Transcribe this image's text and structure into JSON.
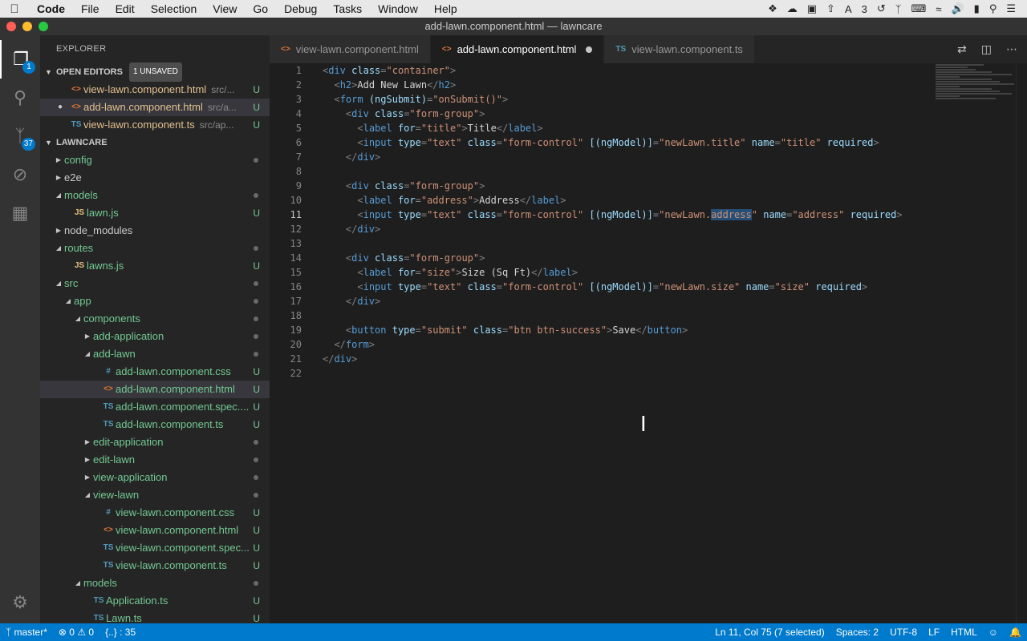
{
  "menubar": {
    "app": "Code",
    "items": [
      "File",
      "Edit",
      "Selection",
      "View",
      "Go",
      "Debug",
      "Tasks",
      "Window",
      "Help"
    ],
    "tray_number": "3"
  },
  "window": {
    "title": "add-lawn.component.html — lawncare"
  },
  "activity": {
    "explorer_badge": "1",
    "scm_badge": "37"
  },
  "sidebar": {
    "title": "EXPLORER",
    "open_editors": {
      "header": "OPEN EDITORS",
      "badge": "1 UNSAVED",
      "items": [
        {
          "icon": "<>",
          "name": "view-lawn.component.html",
          "path": "src/...",
          "status": "U"
        },
        {
          "icon": "<>",
          "name": "add-lawn.component.html",
          "path": "src/a...",
          "status": "U"
        },
        {
          "icon": "TS",
          "name": "view-lawn.component.ts",
          "path": "src/ap...",
          "status": "U"
        }
      ]
    },
    "project": {
      "header": "LAWNCARE",
      "tree": [
        {
          "name": "config",
          "type": "folder",
          "level": 0,
          "expanded": false,
          "mark": "dot"
        },
        {
          "name": "e2e",
          "type": "folder",
          "level": 0,
          "expanded": false,
          "mark": ""
        },
        {
          "name": "models",
          "type": "folder",
          "level": 0,
          "expanded": true,
          "mark": "dot"
        },
        {
          "name": "lawn.js",
          "type": "js",
          "level": 1,
          "mark": "U"
        },
        {
          "name": "node_modules",
          "type": "folder",
          "level": 0,
          "expanded": false,
          "mark": ""
        },
        {
          "name": "routes",
          "type": "folder",
          "level": 0,
          "expanded": true,
          "mark": "dot"
        },
        {
          "name": "lawns.js",
          "type": "js",
          "level": 1,
          "mark": "U"
        },
        {
          "name": "src",
          "type": "folder",
          "level": 0,
          "expanded": true,
          "mark": "dot"
        },
        {
          "name": "app",
          "type": "folder",
          "level": 1,
          "expanded": true,
          "mark": "dot"
        },
        {
          "name": "components",
          "type": "folder",
          "level": 2,
          "expanded": true,
          "mark": "dot"
        },
        {
          "name": "add-application",
          "type": "folder",
          "level": 3,
          "expanded": false,
          "mark": "dot"
        },
        {
          "name": "add-lawn",
          "type": "folder",
          "level": 3,
          "expanded": true,
          "mark": "dot"
        },
        {
          "name": "add-lawn.component.css",
          "type": "css",
          "level": 4,
          "mark": "U"
        },
        {
          "name": "add-lawn.component.html",
          "type": "html",
          "level": 4,
          "mark": "U",
          "selected": true
        },
        {
          "name": "add-lawn.component.spec....",
          "type": "ts",
          "level": 4,
          "mark": "U"
        },
        {
          "name": "add-lawn.component.ts",
          "type": "ts",
          "level": 4,
          "mark": "U"
        },
        {
          "name": "edit-application",
          "type": "folder",
          "level": 3,
          "expanded": false,
          "mark": "dot"
        },
        {
          "name": "edit-lawn",
          "type": "folder",
          "level": 3,
          "expanded": false,
          "mark": "dot"
        },
        {
          "name": "view-application",
          "type": "folder",
          "level": 3,
          "expanded": false,
          "mark": "dot"
        },
        {
          "name": "view-lawn",
          "type": "folder",
          "level": 3,
          "expanded": true,
          "mark": "dot"
        },
        {
          "name": "view-lawn.component.css",
          "type": "css",
          "level": 4,
          "mark": "U"
        },
        {
          "name": "view-lawn.component.html",
          "type": "html",
          "level": 4,
          "mark": "U"
        },
        {
          "name": "view-lawn.component.spec...",
          "type": "ts",
          "level": 4,
          "mark": "U"
        },
        {
          "name": "view-lawn.component.ts",
          "type": "ts",
          "level": 4,
          "mark": "U"
        },
        {
          "name": "models",
          "type": "folder",
          "level": 2,
          "expanded": true,
          "mark": "dot"
        },
        {
          "name": "Application.ts",
          "type": "ts",
          "level": 3,
          "mark": "U"
        },
        {
          "name": "Lawn.ts",
          "type": "ts",
          "level": 3,
          "mark": "U"
        }
      ]
    }
  },
  "tabs": [
    {
      "icon": "<>",
      "label": "view-lawn.component.html",
      "active": false,
      "modified": false
    },
    {
      "icon": "<>",
      "label": "add-lawn.component.html",
      "active": true,
      "modified": true
    },
    {
      "icon": "TS",
      "label": "view-lawn.component.ts",
      "active": false,
      "modified": false
    }
  ],
  "editor": {
    "current_line": 11,
    "lines": [
      [
        [
          "b",
          "<"
        ],
        [
          "t",
          "div"
        ],
        [
          "a",
          " class"
        ],
        [
          "b",
          "="
        ],
        [
          "s",
          "\"container\""
        ],
        [
          "b",
          ">"
        ]
      ],
      [
        [
          "x",
          "  "
        ],
        [
          "b",
          "<"
        ],
        [
          "t",
          "h2"
        ],
        [
          "b",
          ">"
        ],
        [
          "x",
          "Add New Lawn"
        ],
        [
          "b",
          "</"
        ],
        [
          "t",
          "h2"
        ],
        [
          "b",
          ">"
        ]
      ],
      [
        [
          "x",
          "  "
        ],
        [
          "b",
          "<"
        ],
        [
          "t",
          "form"
        ],
        [
          "a",
          " (ngSubmit)"
        ],
        [
          "b",
          "="
        ],
        [
          "s",
          "\"onSubmit()\""
        ],
        [
          "b",
          ">"
        ]
      ],
      [
        [
          "x",
          "    "
        ],
        [
          "b",
          "<"
        ],
        [
          "t",
          "div"
        ],
        [
          "a",
          " class"
        ],
        [
          "b",
          "="
        ],
        [
          "s",
          "\"form-group\""
        ],
        [
          "b",
          ">"
        ]
      ],
      [
        [
          "x",
          "      "
        ],
        [
          "b",
          "<"
        ],
        [
          "t",
          "label"
        ],
        [
          "a",
          " for"
        ],
        [
          "b",
          "="
        ],
        [
          "s",
          "\"title\""
        ],
        [
          "b",
          ">"
        ],
        [
          "x",
          "Title"
        ],
        [
          "b",
          "</"
        ],
        [
          "t",
          "label"
        ],
        [
          "b",
          ">"
        ]
      ],
      [
        [
          "x",
          "      "
        ],
        [
          "b",
          "<"
        ],
        [
          "t",
          "input"
        ],
        [
          "a",
          " type"
        ],
        [
          "b",
          "="
        ],
        [
          "s",
          "\"text\""
        ],
        [
          "a",
          " class"
        ],
        [
          "b",
          "="
        ],
        [
          "s",
          "\"form-control\""
        ],
        [
          "a",
          " [(ngModel)]"
        ],
        [
          "b",
          "="
        ],
        [
          "s",
          "\"newLawn.title\""
        ],
        [
          "a",
          " name"
        ],
        [
          "b",
          "="
        ],
        [
          "s",
          "\"title\""
        ],
        [
          "a",
          " required"
        ],
        [
          "b",
          ">"
        ]
      ],
      [
        [
          "x",
          "    "
        ],
        [
          "b",
          "</"
        ],
        [
          "t",
          "div"
        ],
        [
          "b",
          ">"
        ]
      ],
      [],
      [
        [
          "x",
          "    "
        ],
        [
          "b",
          "<"
        ],
        [
          "t",
          "div"
        ],
        [
          "a",
          " class"
        ],
        [
          "b",
          "="
        ],
        [
          "s",
          "\"form-group\""
        ],
        [
          "b",
          ">"
        ]
      ],
      [
        [
          "x",
          "      "
        ],
        [
          "b",
          "<"
        ],
        [
          "t",
          "label"
        ],
        [
          "a",
          " for"
        ],
        [
          "b",
          "="
        ],
        [
          "s",
          "\"address\""
        ],
        [
          "b",
          ">"
        ],
        [
          "x",
          "Address"
        ],
        [
          "b",
          "</"
        ],
        [
          "t",
          "label"
        ],
        [
          "b",
          ">"
        ]
      ],
      [
        [
          "x",
          "      "
        ],
        [
          "b",
          "<"
        ],
        [
          "t",
          "input"
        ],
        [
          "a",
          " type"
        ],
        [
          "b",
          "="
        ],
        [
          "s",
          "\"text\""
        ],
        [
          "a",
          " class"
        ],
        [
          "b",
          "="
        ],
        [
          "s",
          "\"form-control\""
        ],
        [
          "a",
          " [(ngModel)]"
        ],
        [
          "b",
          "="
        ],
        [
          "s",
          "\"newLawn."
        ],
        [
          "S",
          "address"
        ],
        [
          "s",
          "\""
        ],
        [
          "a",
          " name"
        ],
        [
          "b",
          "="
        ],
        [
          "s",
          "\"address\""
        ],
        [
          "a",
          " required"
        ],
        [
          "b",
          ">"
        ]
      ],
      [
        [
          "x",
          "    "
        ],
        [
          "b",
          "</"
        ],
        [
          "t",
          "div"
        ],
        [
          "b",
          ">"
        ]
      ],
      [],
      [
        [
          "x",
          "    "
        ],
        [
          "b",
          "<"
        ],
        [
          "t",
          "div"
        ],
        [
          "a",
          " class"
        ],
        [
          "b",
          "="
        ],
        [
          "s",
          "\"form-group\""
        ],
        [
          "b",
          ">"
        ]
      ],
      [
        [
          "x",
          "      "
        ],
        [
          "b",
          "<"
        ],
        [
          "t",
          "label"
        ],
        [
          "a",
          " for"
        ],
        [
          "b",
          "="
        ],
        [
          "s",
          "\"size\""
        ],
        [
          "b",
          ">"
        ],
        [
          "x",
          "Size (Sq Ft)"
        ],
        [
          "b",
          "</"
        ],
        [
          "t",
          "label"
        ],
        [
          "b",
          ">"
        ]
      ],
      [
        [
          "x",
          "      "
        ],
        [
          "b",
          "<"
        ],
        [
          "t",
          "input"
        ],
        [
          "a",
          " type"
        ],
        [
          "b",
          "="
        ],
        [
          "s",
          "\"text\""
        ],
        [
          "a",
          " class"
        ],
        [
          "b",
          "="
        ],
        [
          "s",
          "\"form-control\""
        ],
        [
          "a",
          " [(ngModel)]"
        ],
        [
          "b",
          "="
        ],
        [
          "s",
          "\"newLawn.size\""
        ],
        [
          "a",
          " name"
        ],
        [
          "b",
          "="
        ],
        [
          "s",
          "\"size\""
        ],
        [
          "a",
          " required"
        ],
        [
          "b",
          ">"
        ]
      ],
      [
        [
          "x",
          "    "
        ],
        [
          "b",
          "</"
        ],
        [
          "t",
          "div"
        ],
        [
          "b",
          ">"
        ]
      ],
      [],
      [
        [
          "x",
          "    "
        ],
        [
          "b",
          "<"
        ],
        [
          "t",
          "button"
        ],
        [
          "a",
          " type"
        ],
        [
          "b",
          "="
        ],
        [
          "s",
          "\"submit\""
        ],
        [
          "a",
          " class"
        ],
        [
          "b",
          "="
        ],
        [
          "s",
          "\"btn btn-success\""
        ],
        [
          "b",
          ">"
        ],
        [
          "x",
          "Save"
        ],
        [
          "b",
          "</"
        ],
        [
          "t",
          "button"
        ],
        [
          "b",
          ">"
        ]
      ],
      [
        [
          "x",
          "  "
        ],
        [
          "b",
          "</"
        ],
        [
          "t",
          "form"
        ],
        [
          "b",
          ">"
        ]
      ],
      [
        [
          "b",
          "</"
        ],
        [
          "t",
          "div"
        ],
        [
          "b",
          ">"
        ]
      ],
      []
    ]
  },
  "statusbar": {
    "branch": "master*",
    "errors": "0",
    "warnings": "0",
    "symbols": "{..} : 35",
    "position": "Ln 11, Col 75 (7 selected)",
    "spaces": "Spaces: 2",
    "encoding": "UTF-8",
    "eol": "LF",
    "language": "HTML"
  },
  "colors": {
    "accent": "#007acc",
    "editor_bg": "#1e1e1e",
    "sidebar_bg": "#252526",
    "untracked": "#73c991"
  }
}
